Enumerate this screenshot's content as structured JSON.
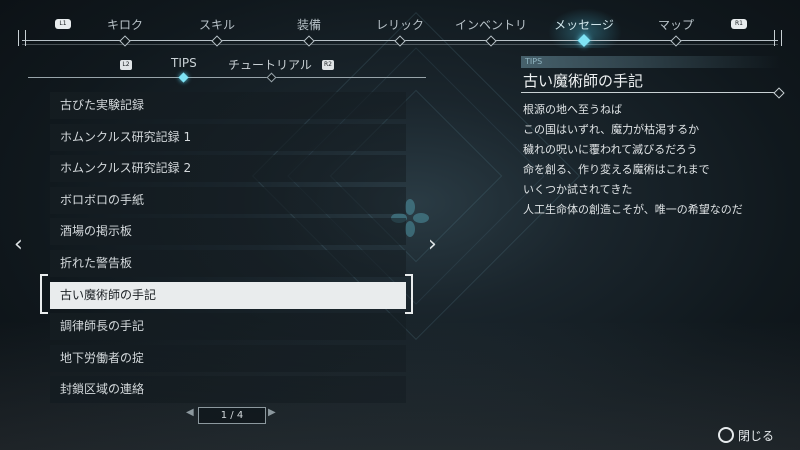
{
  "nav": {
    "l1": "L1",
    "r1": "R1",
    "tabs": [
      "キロク",
      "スキル",
      "装備",
      "レリック",
      "インベントリ",
      "メッセージ",
      "マップ"
    ],
    "active_index": 5
  },
  "subtabs": {
    "l2": "L2",
    "r2": "R2",
    "tabs": [
      "TIPS",
      "チュートリアル"
    ],
    "active_index": 0
  },
  "list": {
    "items": [
      "古びた実験記録",
      "ホムンクルス研究記録 1",
      "ホムンクルス研究記録 2",
      "ボロボロの手紙",
      "酒場の掲示板",
      "折れた警告板",
      "古い魔術師の手記",
      "調律師長の手記",
      "地下労働者の掟",
      "封鎖区域の連絡"
    ],
    "selected_index": 6
  },
  "pager": {
    "text": "1 / 4"
  },
  "detail": {
    "category": "TIPS",
    "title": "古い魔術師の手記",
    "lines": [
      "根源の地へ至うねば",
      "この国はいずれ、魔力が枯渇するか",
      "穢れの呪いに覆われて滅びるだろう",
      "命を創る、作り変える魔術はこれまで",
      "いくつか試されてきた",
      "人工生命体の創造こそが、唯一の希望なのだ"
    ]
  },
  "footer": {
    "close_label": "閉じる"
  },
  "colors": {
    "accent": "#7fe3f5",
    "selected_bg": "#e9eced"
  }
}
